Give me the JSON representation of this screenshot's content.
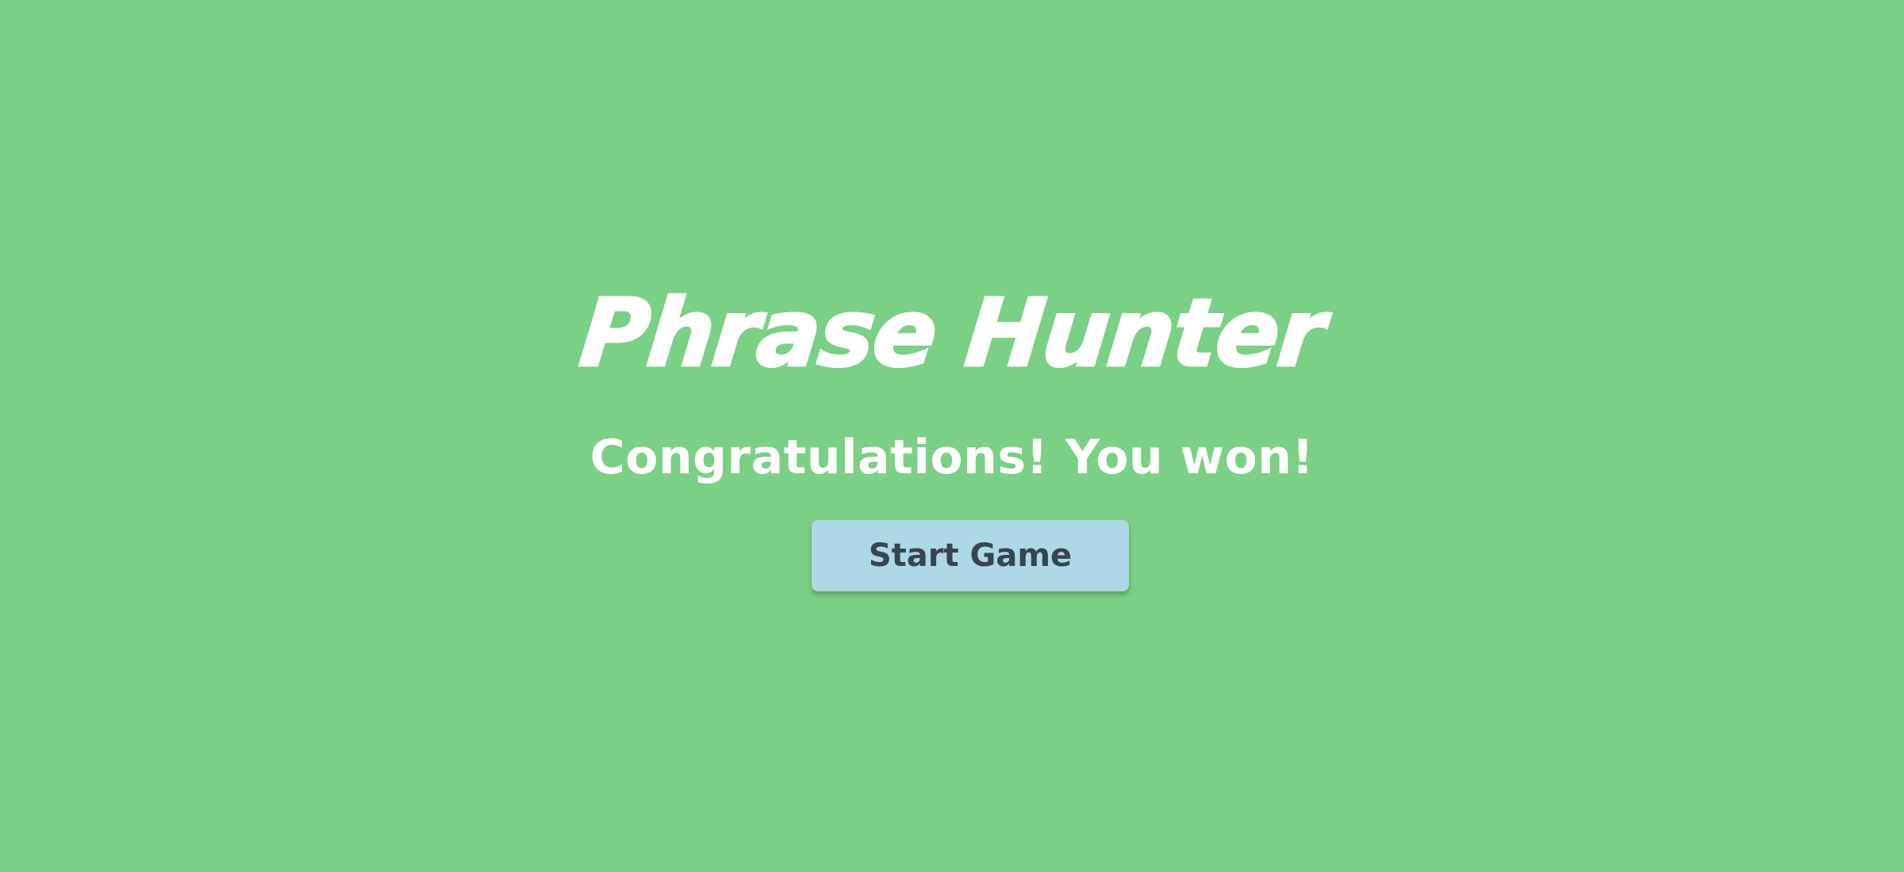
{
  "game": {
    "title": "Phrase Hunter",
    "result_message": "Congratulations! You won!",
    "start_button_label": "Start Game"
  },
  "colors": {
    "background": "#7ad084",
    "title_text": "#ffffff",
    "button_background": "#add8e6",
    "button_text": "#36454f"
  }
}
